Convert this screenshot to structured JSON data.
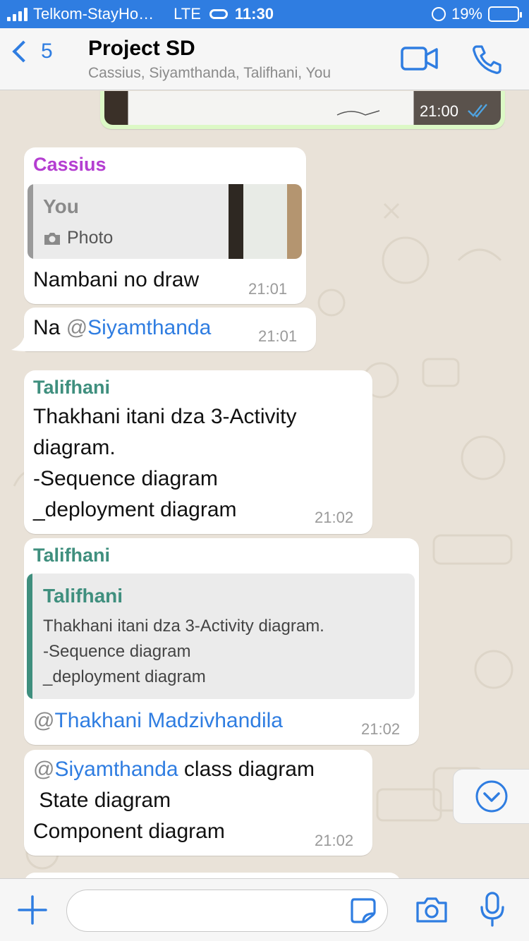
{
  "status_bar": {
    "carrier": "Telkom-StayHo…",
    "network": "LTE",
    "time": "11:30",
    "battery": "19%",
    "battery_level": 0.19
  },
  "header": {
    "back_count": "5",
    "title": "Project SD",
    "subtitle": "Cassius, Siyamthanda, Talifhani, You"
  },
  "messages": [
    {
      "time": "21:00"
    },
    {
      "sender": "Cassius",
      "sender_color": "#b43ed1",
      "quote_author": "You",
      "quote_text": "Photo",
      "text": "Nambani no draw",
      "time": "21:01"
    },
    {
      "text_prefix": "Na ",
      "at": "@",
      "mention": "Siyamthanda",
      "time": "21:01"
    },
    {
      "sender": "Talifhani",
      "sender_color": "#3f8f7e",
      "lines": [
        "Thakhani itani dza 3-Activity",
        "diagram.",
        "-Sequence diagram",
        "_deployment diagram"
      ],
      "time": "21:02"
    },
    {
      "sender": "Talifhani",
      "quote_author": "Talifhani",
      "quote_lines": [
        "Thakhani itani dza 3-Activity diagram.",
        "-Sequence diagram",
        "_deployment diagram"
      ],
      "at": "@",
      "mention": "Thakhani Madzivhandila",
      "time": "21:02"
    },
    {
      "at": "@",
      "mention": "Siyamthanda",
      "rest": " class diagram",
      "lines": [
        " State diagram",
        "Component diagram"
      ],
      "time": "21:02"
    }
  ],
  "colors": {
    "accent": "#2f7de1",
    "outgoing_bubble": "#dcf8c6",
    "incoming_bubble": "#ffffff",
    "chat_background": "#e9e2d8",
    "read_ticks": "#4fa3e0"
  },
  "icons": {
    "back": "chevron-left-icon",
    "video": "video-camera-icon",
    "call": "phone-icon",
    "scroll": "chevron-down-circle-icon",
    "attach": "plus-icon",
    "sticker": "sticker-icon",
    "camera": "camera-icon",
    "mic": "microphone-icon"
  }
}
